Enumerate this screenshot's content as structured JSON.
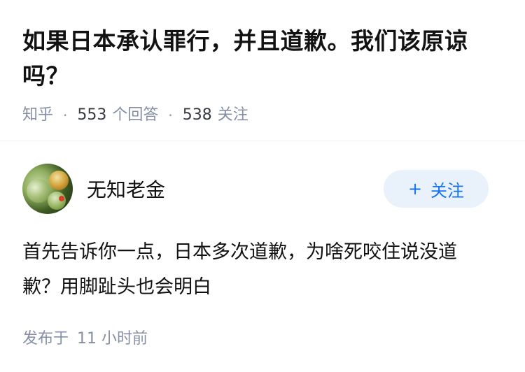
{
  "question": {
    "title": "如果日本承认罪行，并且道歉。我们该原谅吗？",
    "source": "知乎",
    "answer_count": "553",
    "answer_label": "个回答",
    "follower_count": "538",
    "follower_label": "关注"
  },
  "answer": {
    "author_name": "无知老金",
    "avatar_icon": "avatar-photo",
    "follow_button": {
      "icon": "plus-icon",
      "plus": "+",
      "label": "关注"
    },
    "content": "首先告诉你一点，日本多次道歉，为啥死咬住说没道歉？用脚趾头也会明白",
    "published_label": "发布于",
    "published_time": "11 小时前"
  },
  "colors": {
    "accent": "#1772f6",
    "follow_bg": "#e9f1fb",
    "meta": "#8590a6",
    "text": "#121212"
  }
}
